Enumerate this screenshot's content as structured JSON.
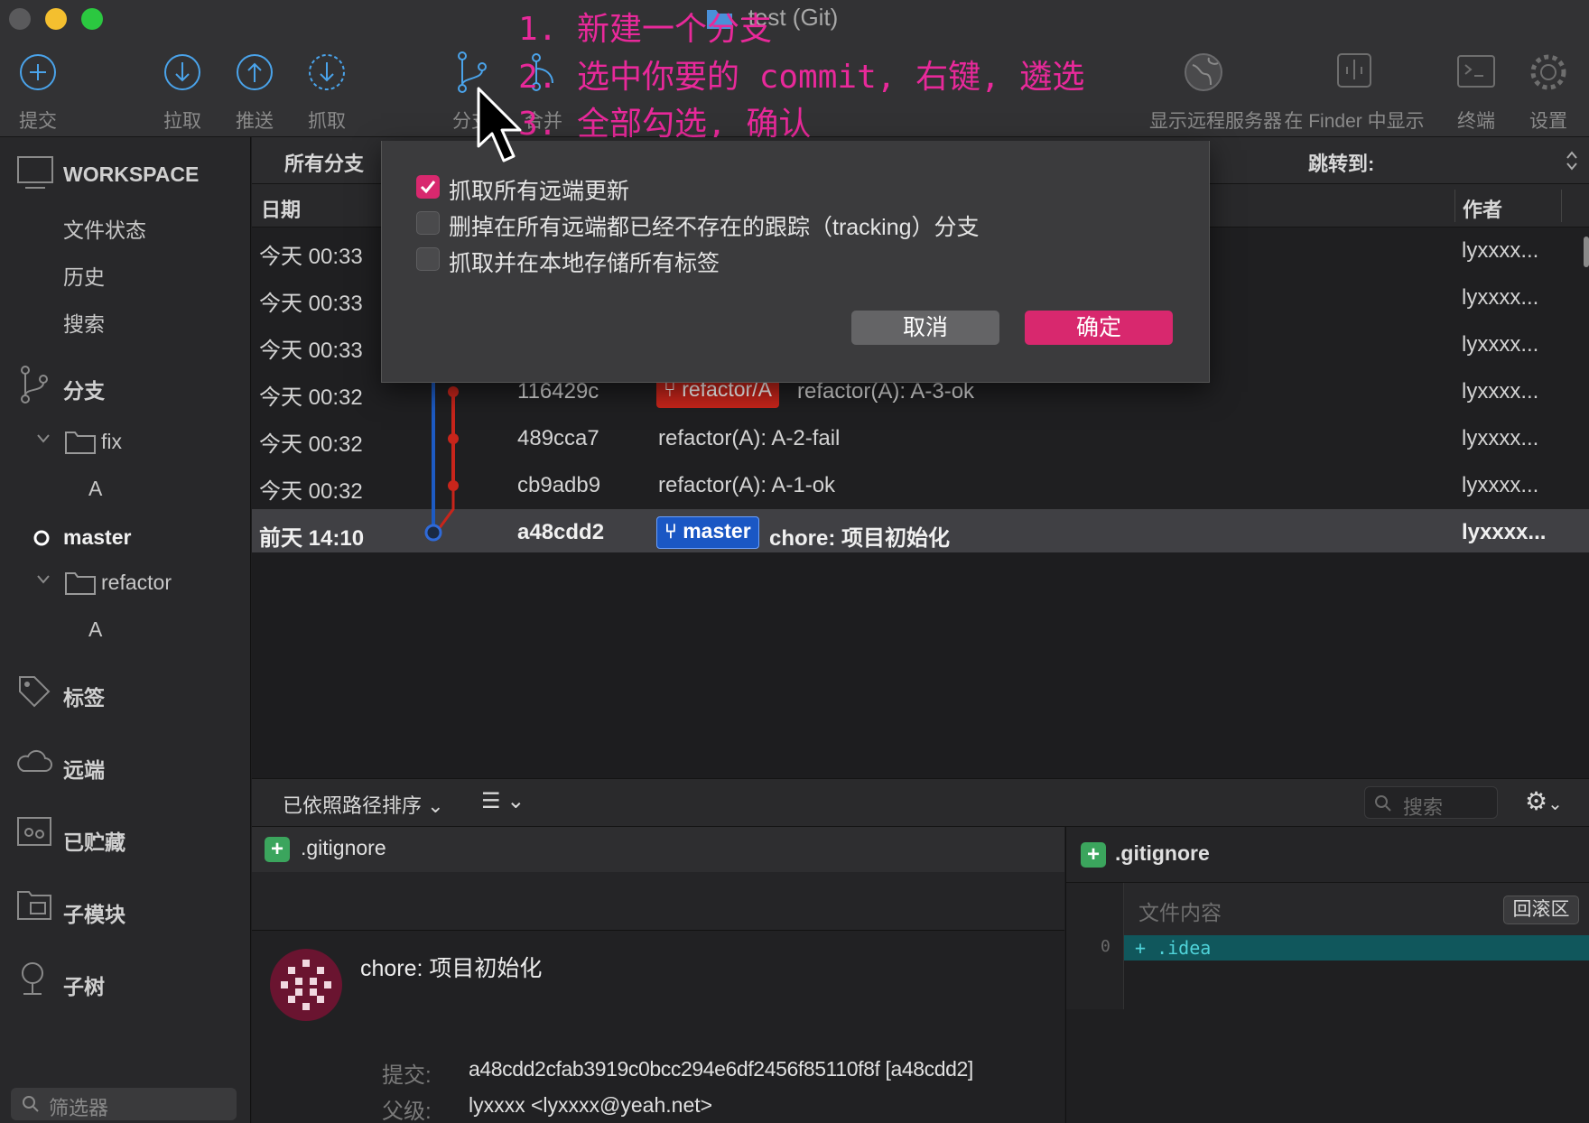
{
  "window": {
    "title": "-test (Git)",
    "annotations": [
      "1. 新建一个分支",
      "2. 选中你要的 commit, 右键, 遴选",
      "3. 全部勾选, 确认"
    ]
  },
  "toolbar": {
    "items": [
      {
        "label": "提交",
        "icon": "commit-icon"
      },
      {
        "label": "拉取",
        "icon": "pull-icon"
      },
      {
        "label": "推送",
        "icon": "push-icon"
      },
      {
        "label": "抓取",
        "icon": "fetch-icon"
      },
      {
        "label": "分支",
        "icon": "branch-icon"
      },
      {
        "label": "合并",
        "icon": "merge-icon"
      },
      {
        "label": "显示远程服务器",
        "icon": "globe-icon"
      },
      {
        "label": "在 Finder 中显示",
        "icon": "finder-icon"
      },
      {
        "label": "终端",
        "icon": "terminal-icon"
      },
      {
        "label": "设置",
        "icon": "gear-icon"
      }
    ]
  },
  "sidebar": {
    "workspace": "WORKSPACE",
    "workspace_items": [
      "文件状态",
      "历史",
      "搜索"
    ],
    "branches": "分支",
    "branch_tree": [
      {
        "folder": "fix",
        "children": [
          "A"
        ]
      },
      {
        "branch": "master",
        "current": true
      },
      {
        "folder": "refactor",
        "children": [
          "A"
        ]
      }
    ],
    "tags": "标签",
    "remotes": "远端",
    "stashes": "已贮藏",
    "submodules": "子模块",
    "subtrees": "子树",
    "filter_placeholder": "筛选器"
  },
  "history": {
    "branch_filter": "所有分支",
    "jump_to": "跳转到:",
    "columns": {
      "date": "日期",
      "author": "作者"
    },
    "commits": [
      {
        "date": "今天 00:33",
        "hash": "",
        "branch_tag": "",
        "message": "",
        "author": "lyxxxx..."
      },
      {
        "date": "今天 00:33",
        "hash": "",
        "branch_tag": "",
        "message": "",
        "author": "lyxxxx..."
      },
      {
        "date": "今天 00:33",
        "hash": "",
        "branch_tag": "",
        "message": "",
        "author": "lyxxxx..."
      },
      {
        "date": "今天 00:32",
        "hash": "116429c",
        "branch_tag": "refactor/A",
        "message": "refactor(A): A-3-ok",
        "author": "lyxxxx..."
      },
      {
        "date": "今天 00:32",
        "hash": "489cca7",
        "branch_tag": "",
        "message": "refactor(A): A-2-fail",
        "author": "lyxxxx..."
      },
      {
        "date": "今天 00:32",
        "hash": "cb9adb9",
        "branch_tag": "",
        "message": "refactor(A): A-1-ok",
        "author": "lyxxxx..."
      },
      {
        "date": "前天 14:10",
        "hash": "a48cdd2",
        "branch_tag": "master",
        "message": "chore: 项目初始化",
        "author": "lyxxxx...",
        "selected": true
      }
    ]
  },
  "files_toolbar": {
    "sort_label": "已依照路径排序",
    "search_placeholder": "搜索"
  },
  "files": [
    {
      "name": ".gitignore",
      "status": "added"
    }
  ],
  "diff": {
    "file": ".gitignore",
    "hunk_label": "文件内容",
    "revert_label": "回滚区",
    "lines": [
      {
        "old_no": "0",
        "text": "+ .idea"
      }
    ]
  },
  "commit_detail": {
    "message": "chore: 项目初始化",
    "commit_label": "提交:",
    "commit_value": "a48cdd2cfab3919c0bcc294e6df2456f85110f8f [a48cdd2]",
    "parent_label": "父级:",
    "parent_value": "lyxxxx <lyxxxx@yeah.net>"
  },
  "dialog": {
    "options": [
      {
        "label": "抓取所有远端更新",
        "checked": true
      },
      {
        "label": "删掉在所有远端都已经不存在的跟踪（tracking）分支",
        "checked": false
      },
      {
        "label": "抓取并在本地存储所有标签",
        "checked": false
      }
    ],
    "cancel": "取消",
    "confirm": "确定"
  },
  "colors": {
    "accent_pink": "#d8286e",
    "annotation": "#e8299a",
    "master_tag": "#1a57c4",
    "refactor_tag": "#c8251b",
    "diff_added": "#10575c"
  }
}
